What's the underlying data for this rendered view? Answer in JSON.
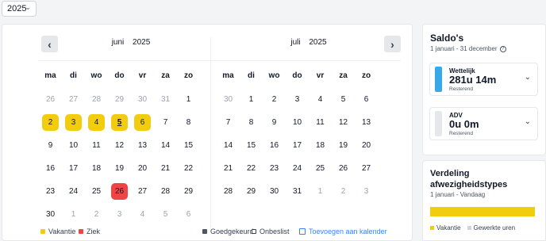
{
  "year_select": {
    "value": "2025"
  },
  "calendar": {
    "weekdays": [
      "ma",
      "di",
      "wo",
      "do",
      "vr",
      "za",
      "zo"
    ],
    "months": [
      {
        "name": "juni",
        "year": "2025",
        "days": [
          {
            "d": "26",
            "s": "muted"
          },
          {
            "d": "27",
            "s": "muted"
          },
          {
            "d": "28",
            "s": "muted"
          },
          {
            "d": "29",
            "s": "muted"
          },
          {
            "d": "30",
            "s": "muted"
          },
          {
            "d": "31",
            "s": "muted"
          },
          {
            "d": "1",
            "s": ""
          },
          {
            "d": "2",
            "s": "vac"
          },
          {
            "d": "3",
            "s": "vac"
          },
          {
            "d": "4",
            "s": "vac"
          },
          {
            "d": "5",
            "s": "vac today"
          },
          {
            "d": "6",
            "s": "vac"
          },
          {
            "d": "7",
            "s": ""
          },
          {
            "d": "8",
            "s": ""
          },
          {
            "d": "9",
            "s": ""
          },
          {
            "d": "10",
            "s": ""
          },
          {
            "d": "11",
            "s": ""
          },
          {
            "d": "12",
            "s": ""
          },
          {
            "d": "13",
            "s": ""
          },
          {
            "d": "14",
            "s": ""
          },
          {
            "d": "15",
            "s": ""
          },
          {
            "d": "16",
            "s": ""
          },
          {
            "d": "17",
            "s": ""
          },
          {
            "d": "18",
            "s": ""
          },
          {
            "d": "19",
            "s": ""
          },
          {
            "d": "20",
            "s": ""
          },
          {
            "d": "21",
            "s": ""
          },
          {
            "d": "22",
            "s": ""
          },
          {
            "d": "23",
            "s": ""
          },
          {
            "d": "24",
            "s": ""
          },
          {
            "d": "25",
            "s": ""
          },
          {
            "d": "26",
            "s": "ill"
          },
          {
            "d": "27",
            "s": ""
          },
          {
            "d": "28",
            "s": ""
          },
          {
            "d": "29",
            "s": ""
          },
          {
            "d": "30",
            "s": ""
          },
          {
            "d": "1",
            "s": "muted"
          },
          {
            "d": "2",
            "s": "muted"
          },
          {
            "d": "3",
            "s": "muted"
          },
          {
            "d": "4",
            "s": "muted"
          },
          {
            "d": "5",
            "s": "muted"
          },
          {
            "d": "6",
            "s": "muted"
          }
        ]
      },
      {
        "name": "juli",
        "year": "2025",
        "days": [
          {
            "d": "30",
            "s": "muted"
          },
          {
            "d": "1",
            "s": ""
          },
          {
            "d": "2",
            "s": ""
          },
          {
            "d": "3",
            "s": ""
          },
          {
            "d": "4",
            "s": ""
          },
          {
            "d": "5",
            "s": ""
          },
          {
            "d": "6",
            "s": ""
          },
          {
            "d": "7",
            "s": ""
          },
          {
            "d": "8",
            "s": ""
          },
          {
            "d": "9",
            "s": ""
          },
          {
            "d": "10",
            "s": ""
          },
          {
            "d": "11",
            "s": ""
          },
          {
            "d": "12",
            "s": ""
          },
          {
            "d": "13",
            "s": ""
          },
          {
            "d": "14",
            "s": ""
          },
          {
            "d": "15",
            "s": ""
          },
          {
            "d": "16",
            "s": ""
          },
          {
            "d": "17",
            "s": ""
          },
          {
            "d": "18",
            "s": ""
          },
          {
            "d": "19",
            "s": ""
          },
          {
            "d": "20",
            "s": ""
          },
          {
            "d": "21",
            "s": ""
          },
          {
            "d": "22",
            "s": ""
          },
          {
            "d": "23",
            "s": ""
          },
          {
            "d": "24",
            "s": ""
          },
          {
            "d": "25",
            "s": ""
          },
          {
            "d": "26",
            "s": ""
          },
          {
            "d": "27",
            "s": ""
          },
          {
            "d": "28",
            "s": ""
          },
          {
            "d": "29",
            "s": ""
          },
          {
            "d": "30",
            "s": ""
          },
          {
            "d": "31",
            "s": ""
          },
          {
            "d": "1",
            "s": "muted"
          },
          {
            "d": "2",
            "s": "muted"
          },
          {
            "d": "3",
            "s": "muted"
          }
        ]
      }
    ],
    "legend": {
      "vacation": "Vakantie",
      "sick": "Ziek",
      "approved": "Goedgekeurd",
      "draft": "Onbeslist",
      "add_calendar": "Toevoegen aan kalender"
    },
    "colors": {
      "vacation": "#f2cc0f",
      "sick": "#ef4444",
      "approved": "#4b5563"
    }
  },
  "saldo": {
    "title": "Saldo's",
    "period": "1 januari - 31 december",
    "cards": [
      {
        "label": "Wettelijk",
        "value": "281u 14m",
        "note": "Resterend",
        "fill": 1.0,
        "color": "#38a9e8"
      },
      {
        "label": "ADV",
        "value": "0u 0m",
        "note": "Resterend",
        "fill": 0.0,
        "color": "#38a9e8"
      }
    ]
  },
  "verdeling": {
    "title": "Verdeling afwezigheidstypes",
    "period": "1 januari - Vandaag",
    "share_vacation": 1.0,
    "legend": {
      "vacation": "Vakantie",
      "worked": "Gewerkte uren"
    }
  }
}
